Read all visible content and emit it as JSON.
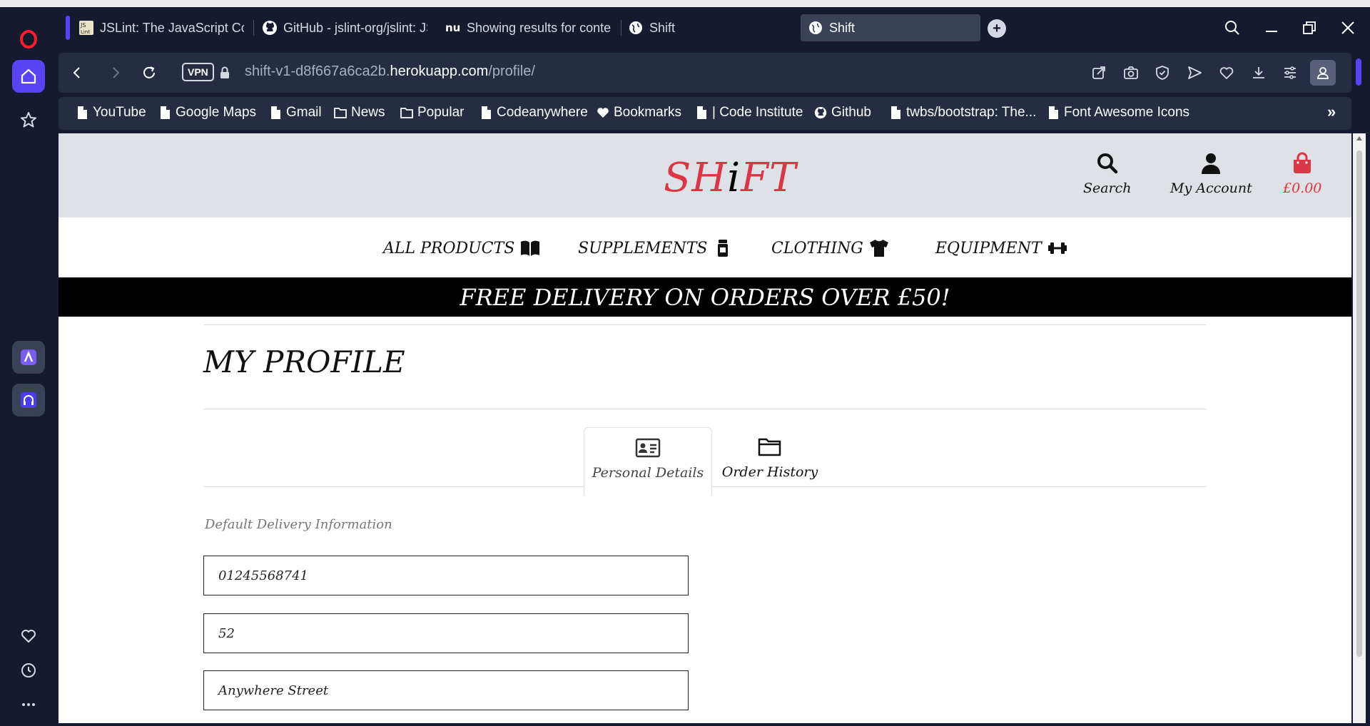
{
  "browser": {
    "tabs": [
      {
        "title": "JSLint: The JavaScript Code Quality Tool",
        "icon": "jslint-favicon"
      },
      {
        "title": "GitHub - jslint-org/jslint: JSLint",
        "icon": "github-icon"
      },
      {
        "title": "Showing results for content",
        "icon": "nu-favicon"
      },
      {
        "title": "Shift",
        "icon": "globe-icon"
      },
      {
        "title": "Shift",
        "icon": "globe-icon"
      }
    ],
    "vpn_label": "VPN",
    "url_prefix": "shift-v1-d8f667a6ca2b.",
    "url_host": "herokuapp.com",
    "url_path": "/profile/",
    "new_tab": "+",
    "bookmarks_more": "»",
    "bookmarks": [
      {
        "label": "YouTube",
        "icon": "page-icon"
      },
      {
        "label": "Google Maps",
        "icon": "page-icon"
      },
      {
        "label": "Gmail",
        "icon": "page-icon"
      },
      {
        "label": "News",
        "icon": "folder-icon"
      },
      {
        "label": "Popular",
        "icon": "folder-icon"
      },
      {
        "label": "Codeanywhere",
        "icon": "page-icon"
      },
      {
        "label": "Bookmarks",
        "icon": "heart-icon"
      },
      {
        "label": "| Code Institute",
        "icon": "page-icon"
      },
      {
        "label": "Github",
        "icon": "github-icon"
      },
      {
        "label": "twbs/bootstrap: The...",
        "icon": "page-icon"
      },
      {
        "label": "Font Awesome Icons",
        "icon": "page-icon"
      }
    ]
  },
  "site": {
    "logo_part1": "SH",
    "logo_i": "i",
    "logo_part2": "FT",
    "search_label": "Search",
    "account_label": "My Account",
    "bag_total": "£0.00",
    "nav": {
      "all_products": "ALL PRODUCTS",
      "supplements": "SUPPLEMENTS",
      "clothing": "CLOTHING",
      "equipment": "EQUIPMENT"
    },
    "banner": "FREE DELIVERY ON ORDERS OVER £50!",
    "accent_color": "#dc3545"
  },
  "profile": {
    "title": "MY PROFILE",
    "tabs": {
      "personal": "Personal Details",
      "orders": "Order History"
    },
    "section_label": "Default Delivery Information",
    "fields": {
      "phone": "01245568741",
      "address1": "52",
      "address2": "Anywhere Street"
    }
  }
}
